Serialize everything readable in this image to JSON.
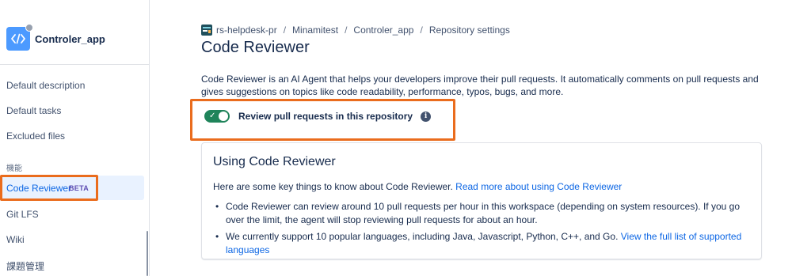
{
  "sidebar": {
    "repo_name": "Controler_app",
    "items": [
      {
        "label": "Default description"
      },
      {
        "label": "Default tasks"
      },
      {
        "label": "Excluded files"
      }
    ],
    "section_label": "機能",
    "active_item": {
      "label": "Code Reviewer",
      "badge": "BETA"
    },
    "items_after": [
      {
        "label": "Git LFS"
      },
      {
        "label": "Wiki"
      },
      {
        "label": "課題管理"
      }
    ]
  },
  "breadcrumb": [
    "rs-helpdesk-pr",
    "Minamitest",
    "Controler_app",
    "Repository settings"
  ],
  "breadcrumb_separator": "/",
  "page_title": "Code Reviewer",
  "description": "Code Reviewer is an AI Agent that helps your developers improve their pull requests. It automatically comments on pull requests and gives suggestions on topics like code readability, performance, typos, bugs, and more.",
  "toggle": {
    "label": "Review pull requests in this repository",
    "enabled": true
  },
  "card": {
    "title": "Using Code Reviewer",
    "intro": "Here are some key things to know about Code Reviewer.",
    "intro_link": "Read more about using Code Reviewer",
    "bullets": [
      {
        "text": "Code Reviewer can review around 10 pull requests per hour in this workspace (depending on system resources). If you go over the limit, the agent will stop reviewing pull requests for about an hour.",
        "link": ""
      },
      {
        "text": "We currently support 10 popular languages, including Java, Javascript, Python, C++, and Go.",
        "link": "View the full list of supported languages"
      }
    ]
  },
  "colors": {
    "accent": "#0c66e4",
    "toggle_on": "#1f845a",
    "highlight": "#ea6c1d",
    "beta": "#5e4db2"
  }
}
